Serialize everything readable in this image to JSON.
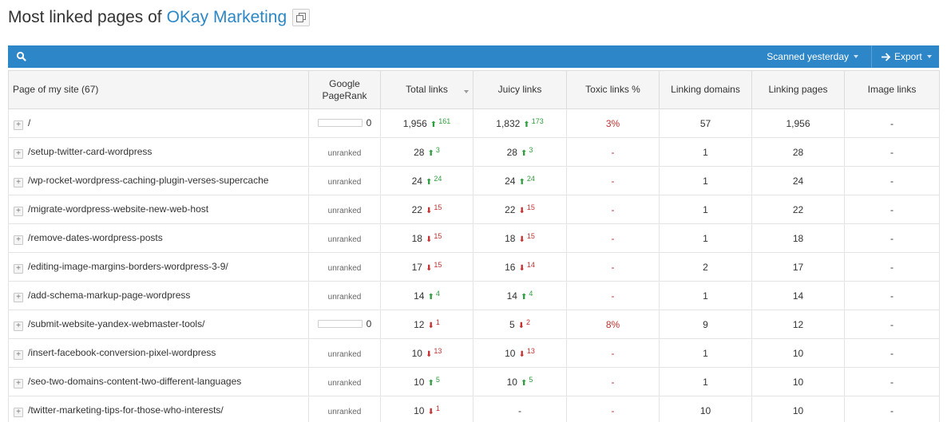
{
  "header": {
    "title": "Most linked pages of",
    "site": "OKay Marketing"
  },
  "toolbar": {
    "scanned_label": "Scanned yesterday",
    "export_label": "Export"
  },
  "columns": [
    "Page of my site (67)",
    "Google PageRank",
    "Total links",
    "Juicy links",
    "Toxic links %",
    "Linking domains",
    "Linking pages",
    "Image links"
  ],
  "rows": [
    {
      "page": "/",
      "pagerank": "0",
      "pr_type": "bar",
      "total": "1,956",
      "total_dir": "up",
      "total_delta": "161",
      "juicy": "1,832",
      "juicy_dir": "up",
      "juicy_delta": "173",
      "toxic": "3%",
      "domains": "57",
      "pages": "1,956",
      "image": "-"
    },
    {
      "page": "/setup-twitter-card-wordpress",
      "pagerank": "unranked",
      "pr_type": "text",
      "total": "28",
      "total_dir": "up",
      "total_delta": "3",
      "juicy": "28",
      "juicy_dir": "up",
      "juicy_delta": "3",
      "toxic": "-",
      "domains": "1",
      "pages": "28",
      "image": "-"
    },
    {
      "page": "/wp-rocket-wordpress-caching-plugin-verses-supercache",
      "pagerank": "unranked",
      "pr_type": "text",
      "total": "24",
      "total_dir": "up",
      "total_delta": "24",
      "juicy": "24",
      "juicy_dir": "up",
      "juicy_delta": "24",
      "toxic": "-",
      "domains": "1",
      "pages": "24",
      "image": "-"
    },
    {
      "page": "/migrate-wordpress-website-new-web-host",
      "pagerank": "unranked",
      "pr_type": "text",
      "total": "22",
      "total_dir": "down",
      "total_delta": "15",
      "juicy": "22",
      "juicy_dir": "down",
      "juicy_delta": "15",
      "toxic": "-",
      "domains": "1",
      "pages": "22",
      "image": "-"
    },
    {
      "page": "/remove-dates-wordpress-posts",
      "pagerank": "unranked",
      "pr_type": "text",
      "total": "18",
      "total_dir": "down",
      "total_delta": "15",
      "juicy": "18",
      "juicy_dir": "down",
      "juicy_delta": "15",
      "toxic": "-",
      "domains": "1",
      "pages": "18",
      "image": "-"
    },
    {
      "page": "/editing-image-margins-borders-wordpress-3-9/",
      "pagerank": "unranked",
      "pr_type": "text",
      "total": "17",
      "total_dir": "down",
      "total_delta": "15",
      "juicy": "16",
      "juicy_dir": "down",
      "juicy_delta": "14",
      "toxic": "-",
      "domains": "2",
      "pages": "17",
      "image": "-"
    },
    {
      "page": "/add-schema-markup-page-wordpress",
      "pagerank": "unranked",
      "pr_type": "text",
      "total": "14",
      "total_dir": "up",
      "total_delta": "4",
      "juicy": "14",
      "juicy_dir": "up",
      "juicy_delta": "4",
      "toxic": "-",
      "domains": "1",
      "pages": "14",
      "image": "-"
    },
    {
      "page": "/submit-website-yandex-webmaster-tools/",
      "pagerank": "0",
      "pr_type": "bar",
      "total": "12",
      "total_dir": "down",
      "total_delta": "1",
      "juicy": "5",
      "juicy_dir": "down",
      "juicy_delta": "2",
      "toxic": "8%",
      "domains": "9",
      "pages": "12",
      "image": "-"
    },
    {
      "page": "/insert-facebook-conversion-pixel-wordpress",
      "pagerank": "unranked",
      "pr_type": "text",
      "total": "10",
      "total_dir": "down",
      "total_delta": "13",
      "juicy": "10",
      "juicy_dir": "down",
      "juicy_delta": "13",
      "toxic": "-",
      "domains": "1",
      "pages": "10",
      "image": "-"
    },
    {
      "page": "/seo-two-domains-content-two-different-languages",
      "pagerank": "unranked",
      "pr_type": "text",
      "total": "10",
      "total_dir": "up",
      "total_delta": "5",
      "juicy": "10",
      "juicy_dir": "up",
      "juicy_delta": "5",
      "toxic": "-",
      "domains": "1",
      "pages": "10",
      "image": "-"
    },
    {
      "page": "/twitter-marketing-tips-for-those-who-interests/",
      "pagerank": "unranked",
      "pr_type": "text",
      "total": "10",
      "total_dir": "down",
      "total_delta": "1",
      "juicy": "-",
      "juicy_dir": "",
      "juicy_delta": "",
      "toxic": "-",
      "domains": "10",
      "pages": "10",
      "image": "-"
    }
  ],
  "colors": {
    "accent": "#2d86c7",
    "link": "#2c87c6",
    "up": "#2e9e3e",
    "down": "#c43030"
  }
}
